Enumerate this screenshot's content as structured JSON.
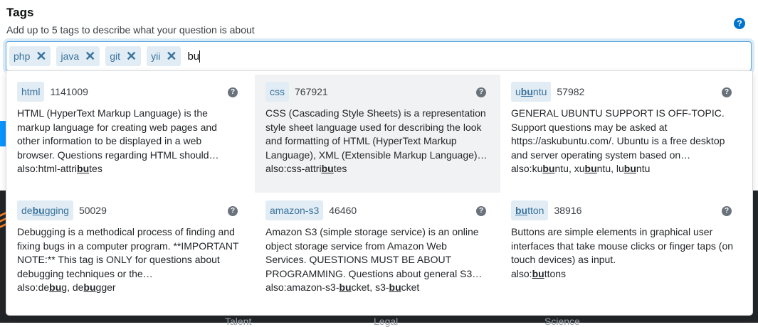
{
  "header": {
    "title": "Tags",
    "description": "Add up to 5 tags to describe what your question is about",
    "help_symbol": "?"
  },
  "tag_input": {
    "chips": [
      {
        "label": "php",
        "remove_symbol": "✕"
      },
      {
        "label": "java",
        "remove_symbol": "✕"
      },
      {
        "label": "git",
        "remove_symbol": "✕"
      },
      {
        "label": "yii",
        "remove_symbol": "✕"
      }
    ],
    "typed_value": "bu"
  },
  "suggestions": [
    {
      "tag": {
        "pre": "html",
        "match": "",
        "post": ""
      },
      "count": "1141009",
      "excerpt": "HTML (HyperText Markup Language) is the markup language for creating web pages and other information to be displayed in a web browser. Questions regarding HTML should…",
      "also": [
        {
          "pre": "html-attri",
          "match": "bu",
          "post": "tes"
        }
      ],
      "selected": false
    },
    {
      "tag": {
        "pre": "css",
        "match": "",
        "post": ""
      },
      "count": "767921",
      "excerpt": "CSS (Cascading Style Sheets) is a representation style sheet language used for describing the look and formatting of HTML (HyperText Markup Language), XML (Extensible Markup Language)…",
      "also": [
        {
          "pre": "css-attri",
          "match": "bu",
          "post": "tes"
        }
      ],
      "selected": true
    },
    {
      "tag": {
        "pre": "u",
        "match": "bu",
        "post": "ntu"
      },
      "count": "57982",
      "excerpt": "GENERAL UBUNTU SUPPORT IS OFF-TOPIC. Support questions may be asked at https://askubuntu.com/. Ubuntu is a free desktop and server operating system based on…",
      "also": [
        {
          "pre": "ku",
          "match": "bu",
          "post": "ntu"
        },
        {
          "pre": "xu",
          "match": "bu",
          "post": "ntu"
        },
        {
          "pre": "lu",
          "match": "bu",
          "post": "ntu"
        }
      ],
      "selected": false
    },
    {
      "tag": {
        "pre": "de",
        "match": "bu",
        "post": "gging"
      },
      "count": "50029",
      "excerpt": "Debugging is a methodical process of finding and fixing bugs in a computer program. **IMPORTANT NOTE:** This tag is ONLY for questions about debugging techniques or the…",
      "also": [
        {
          "pre": "de",
          "match": "bu",
          "post": "g"
        },
        {
          "pre": "de",
          "match": "bu",
          "post": "gger"
        }
      ],
      "selected": false
    },
    {
      "tag": {
        "pre": "amazon-s3",
        "match": "",
        "post": ""
      },
      "count": "46460",
      "excerpt": "Amazon S3 (simple storage service) is an online object storage service from Amazon Web Services. QUESTIONS MUST BE ABOUT PROGRAMMING. Questions about general S3…",
      "also": [
        {
          "pre": "amazon-s3-",
          "match": "bu",
          "post": "cket"
        },
        {
          "pre": "s3-",
          "match": "bu",
          "post": "cket"
        }
      ],
      "selected": false
    },
    {
      "tag": {
        "pre": "",
        "match": "bu",
        "post": "tton"
      },
      "count": "38916",
      "excerpt": "Buttons are simple elements in graphical user interfaces that take mouse clicks or finger taps (on touch devices) as input.",
      "also": [
        {
          "pre": "",
          "match": "bu",
          "post": "ttons"
        }
      ],
      "selected": false
    }
  ],
  "also_prefix": "also:",
  "also_separator": ", ",
  "card_help_symbol": "?",
  "footer": {
    "links": [
      "Talent",
      "Legal",
      "Science"
    ]
  },
  "colors": {
    "accent": "#0074cc",
    "tag_bg": "#e1ecf4",
    "tag_text": "#39739d",
    "selected_bg": "#f1f2f3",
    "footer_bg": "#232629"
  }
}
